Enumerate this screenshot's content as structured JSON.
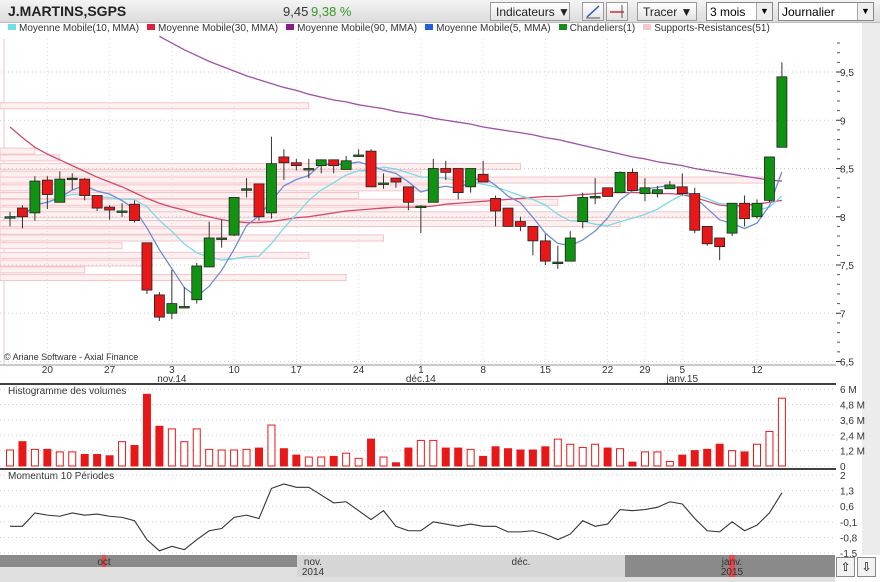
{
  "header": {
    "title": "J.MARTINS,SGPS",
    "last": "9,45",
    "change": "9,38 %",
    "indicators_label": "Indicateurs ▼",
    "draw_label": "Tracer ▼",
    "period_value": "3 mois",
    "interval_value": "Journalier",
    "dropdown_arrow": "▼"
  },
  "legend": [
    {
      "label": "Moyenne Mobile(10, MMA)",
      "color": "#6fe0e8"
    },
    {
      "label": "Moyenne Mobile(30, MMA)",
      "color": "#e0203a"
    },
    {
      "label": "Moyenne Mobile(90, MMA)",
      "color": "#8a1a8a"
    },
    {
      "label": "Moyenne Mobile(5, MMA)",
      "color": "#2060d0"
    },
    {
      "label": "Chandeliers(1)",
      "color": "#1a8a1a"
    },
    {
      "label": "Supports-Resistances(51)",
      "color": "#f6c8cc"
    }
  ],
  "copyright": "© Ariane Software - Axial Finance",
  "colors": {
    "up": "#129212",
    "down": "#e81818",
    "ma10": "#78dce4",
    "ma30": "#d04a6a",
    "ma90": "#a050a8",
    "ma5": "#6a8ed8",
    "sr": "#f4c4c8",
    "volume": "#e81818",
    "momentum": "#333333"
  },
  "chart_data": [
    {
      "type": "candlestick",
      "yticks": [
        {
          "v": 9.5,
          "l": "9,5"
        },
        {
          "v": 9,
          "l": "9"
        },
        {
          "v": 8.5,
          "l": "8,5"
        },
        {
          "v": 8,
          "l": "8"
        },
        {
          "v": 7.5,
          "l": "7,5"
        },
        {
          "v": 7,
          "l": "7"
        },
        {
          "v": 6.5,
          "l": "6,5"
        }
      ],
      "ylim": [
        6.5,
        9.85
      ],
      "xlabels": [
        {
          "i": 3,
          "l": "20"
        },
        {
          "i": 8,
          "l": "27"
        },
        {
          "i": 13,
          "l": "3",
          "sub": "nov.14"
        },
        {
          "i": 18,
          "l": "10"
        },
        {
          "i": 23,
          "l": "17"
        },
        {
          "i": 28,
          "l": "24"
        },
        {
          "i": 33,
          "l": "1",
          "sub": "déc.14"
        },
        {
          "i": 38,
          "l": "8"
        },
        {
          "i": 43,
          "l": "15"
        },
        {
          "i": 48,
          "l": "22"
        },
        {
          "i": 51,
          "l": "29"
        },
        {
          "i": 54,
          "l": "5",
          "sub": "janv.15"
        },
        {
          "i": 60,
          "l": "12"
        }
      ],
      "ohlc": [
        [
          8.0,
          8.05,
          7.9,
          8.0
        ],
        [
          8.09,
          8.12,
          7.88,
          8.0
        ],
        [
          8.04,
          8.42,
          7.96,
          8.37
        ],
        [
          8.38,
          8.42,
          8.08,
          8.23
        ],
        [
          8.15,
          8.47,
          8.15,
          8.39
        ],
        [
          8.4,
          8.45,
          8.28,
          8.4
        ],
        [
          8.39,
          8.4,
          8.17,
          8.22
        ],
        [
          8.22,
          8.22,
          8.06,
          8.09
        ],
        [
          8.1,
          8.12,
          7.97,
          8.07
        ],
        [
          8.06,
          8.14,
          8.0,
          8.06
        ],
        [
          8.13,
          8.17,
          7.94,
          7.96
        ],
        [
          7.73,
          7.73,
          7.2,
          7.24
        ],
        [
          7.19,
          7.22,
          6.92,
          6.96
        ],
        [
          7.0,
          7.45,
          6.94,
          7.1
        ],
        [
          7.07,
          7.27,
          7.05,
          7.07
        ],
        [
          7.14,
          7.52,
          7.1,
          7.49
        ],
        [
          7.48,
          7.95,
          7.48,
          7.78
        ],
        [
          7.78,
          7.97,
          7.68,
          7.78
        ],
        [
          7.81,
          8.2,
          7.8,
          8.2
        ],
        [
          8.29,
          8.4,
          8.2,
          8.29
        ],
        [
          8.34,
          8.34,
          7.96,
          8.0
        ],
        [
          8.04,
          8.83,
          7.98,
          8.55
        ],
        [
          8.62,
          8.7,
          8.38,
          8.56
        ],
        [
          8.56,
          8.6,
          8.48,
          8.53
        ],
        [
          8.5,
          8.6,
          8.4,
          8.5
        ],
        [
          8.53,
          8.59,
          8.45,
          8.59
        ],
        [
          8.59,
          8.59,
          8.45,
          8.53
        ],
        [
          8.49,
          8.63,
          8.49,
          8.58
        ],
        [
          8.64,
          8.7,
          8.62,
          8.64
        ],
        [
          8.68,
          8.7,
          8.31,
          8.31
        ],
        [
          8.35,
          8.45,
          8.29,
          8.35
        ],
        [
          8.4,
          8.4,
          8.3,
          8.36
        ],
        [
          8.31,
          8.31,
          8.07,
          8.15
        ],
        [
          8.11,
          8.12,
          7.83,
          8.11
        ],
        [
          8.15,
          8.6,
          8.15,
          8.5
        ],
        [
          8.5,
          8.58,
          8.38,
          8.46
        ],
        [
          8.5,
          8.5,
          8.18,
          8.25
        ],
        [
          8.31,
          8.5,
          8.25,
          8.5
        ],
        [
          8.44,
          8.58,
          8.36,
          8.36
        ],
        [
          8.19,
          8.22,
          7.9,
          8.06
        ],
        [
          8.09,
          8.09,
          7.9,
          7.9
        ],
        [
          7.95,
          8.0,
          7.85,
          7.9
        ],
        [
          7.9,
          7.9,
          7.6,
          7.75
        ],
        [
          7.75,
          7.82,
          7.5,
          7.54
        ],
        [
          7.53,
          7.7,
          7.46,
          7.53
        ],
        [
          7.54,
          7.85,
          7.54,
          7.78
        ],
        [
          7.95,
          8.25,
          7.88,
          8.2
        ],
        [
          8.21,
          8.4,
          8.13,
          8.21
        ],
        [
          8.3,
          8.3,
          8.21,
          8.21
        ],
        [
          8.25,
          8.47,
          8.25,
          8.46
        ],
        [
          8.46,
          8.5,
          8.27,
          8.27
        ],
        [
          8.24,
          8.4,
          8.16,
          8.3
        ],
        [
          8.24,
          8.32,
          8.2,
          8.28
        ],
        [
          8.29,
          8.37,
          8.29,
          8.33
        ],
        [
          8.31,
          8.45,
          8.22,
          8.24
        ],
        [
          8.24,
          8.3,
          7.83,
          7.86
        ],
        [
          7.9,
          7.9,
          7.7,
          7.72
        ],
        [
          7.78,
          7.78,
          7.55,
          7.69
        ],
        [
          7.83,
          8.14,
          7.8,
          8.14
        ],
        [
          8.14,
          8.22,
          7.9,
          7.98
        ],
        [
          8.0,
          8.18,
          7.98,
          8.14
        ],
        [
          8.17,
          8.62,
          8.15,
          8.62
        ],
        [
          8.72,
          9.6,
          8.72,
          9.45
        ]
      ],
      "ma30": [
        8.93,
        8.82,
        8.72,
        8.65,
        8.59,
        8.53,
        8.47,
        8.41,
        8.36,
        8.31,
        8.25,
        8.19,
        8.14,
        8.1,
        8.07,
        8.03,
        8.0,
        7.97,
        7.95,
        7.94,
        7.94,
        7.95,
        7.97,
        7.99,
        8.0,
        8.02,
        8.04,
        8.06,
        8.07,
        8.08,
        8.09,
        8.1,
        8.1,
        8.1,
        8.11,
        8.13,
        8.14,
        8.15,
        8.16,
        8.17,
        8.18,
        8.19,
        8.2,
        8.21,
        8.21,
        8.22,
        8.23,
        8.24,
        8.25,
        8.25,
        8.25,
        8.25,
        8.24,
        8.24,
        8.23,
        8.2,
        8.16,
        8.12,
        8.11,
        8.12,
        8.13,
        8.15,
        8.17
      ],
      "ma90": [
        null,
        null,
        null,
        null,
        null,
        null,
        null,
        null,
        null,
        null,
        null,
        null,
        9.87,
        9.8,
        9.73,
        9.67,
        9.61,
        9.56,
        9.51,
        9.46,
        9.42,
        9.38,
        9.34,
        9.31,
        9.27,
        9.24,
        9.21,
        9.19,
        9.16,
        9.14,
        9.12,
        9.09,
        9.07,
        9.05,
        9.02,
        9.0,
        8.98,
        8.96,
        8.93,
        8.91,
        8.89,
        8.87,
        8.85,
        8.82,
        8.8,
        8.77,
        8.74,
        8.71,
        8.68,
        8.65,
        8.62,
        8.6,
        8.57,
        8.55,
        8.53,
        8.5,
        8.48,
        8.46,
        8.44,
        8.42,
        8.4,
        8.38,
        8.37
      ],
      "supports_resistances": [
        [
          9.15,
          24
        ],
        [
          8.68,
          2
        ],
        [
          8.61,
          4
        ],
        [
          8.52,
          41
        ],
        [
          8.44,
          33
        ],
        [
          8.38,
          61
        ],
        [
          8.3,
          34
        ],
        [
          8.22,
          28
        ],
        [
          8.15,
          44
        ],
        [
          8.07,
          32
        ],
        [
          8.02,
          59
        ],
        [
          7.93,
          49
        ],
        [
          7.85,
          17
        ],
        [
          7.78,
          30
        ],
        [
          7.7,
          9
        ],
        [
          7.6,
          24
        ],
        [
          7.52,
          11
        ],
        [
          7.45,
          6
        ],
        [
          7.37,
          27
        ]
      ]
    },
    {
      "type": "bar",
      "title": "Histogramme des volumes",
      "unit": "M",
      "yticks": [
        {
          "v": 6,
          "l": "6 M"
        },
        {
          "v": 4.8,
          "l": "4,8 M"
        },
        {
          "v": 3.6,
          "l": "3,6 M"
        },
        {
          "v": 2.4,
          "l": "2,4 M"
        },
        {
          "v": 1.2,
          "l": "1,2 M"
        },
        {
          "v": 0,
          "l": "0"
        }
      ],
      "values": [
        1.25,
        1.9,
        1.3,
        1.3,
        1.1,
        1.1,
        0.9,
        0.9,
        0.8,
        1.9,
        1.6,
        5.6,
        3.1,
        2.9,
        1.9,
        2.9,
        1.3,
        1.25,
        1.25,
        1.3,
        1.4,
        3.2,
        1.35,
        0.85,
        0.7,
        0.7,
        0.75,
        1.0,
        0.6,
        2.1,
        0.7,
        0.25,
        1.4,
        2.0,
        2.0,
        1.4,
        1.4,
        1.3,
        0.75,
        1.5,
        1.35,
        1.25,
        1.25,
        1.5,
        2.1,
        1.7,
        1.45,
        1.7,
        1.4,
        1.35,
        0.3,
        1.1,
        1.1,
        0.35,
        0.85,
        1.2,
        1.3,
        1.7,
        1.2,
        1.1,
        1.7,
        2.7,
        5.3
      ]
    },
    {
      "type": "line",
      "title": "Momentum 10 Périodes",
      "yticks": [
        {
          "v": 2,
          "l": "2"
        },
        {
          "v": 1.3,
          "l": "1,3"
        },
        {
          "v": 0.6,
          "l": "0,6"
        },
        {
          "v": -0.1,
          "l": "-0,1"
        },
        {
          "v": -0.8,
          "l": "-0,8"
        },
        {
          "v": -1.5,
          "l": "-1,5"
        }
      ],
      "values": [
        -0.3,
        -0.3,
        0.3,
        0.2,
        0.15,
        0.3,
        0.2,
        0.25,
        0.15,
        0.1,
        -0.05,
        -0.9,
        -1.4,
        -1.2,
        -1.35,
        -0.9,
        -0.5,
        -0.4,
        0.1,
        0.2,
        0.05,
        1.4,
        1.6,
        1.45,
        1.45,
        1.1,
        0.75,
        0.8,
        0.4,
        0.0,
        0.4,
        -0.3,
        -0.5,
        -0.5,
        -0.1,
        -0.2,
        -0.3,
        -0.2,
        -0.3,
        -0.3,
        -0.55,
        -0.55,
        -0.5,
        -0.65,
        -0.9,
        -0.65,
        -0.05,
        -0.3,
        -0.2,
        0.45,
        0.4,
        0.45,
        0.55,
        0.8,
        0.7,
        0.05,
        -0.5,
        -0.55,
        -0.1,
        -0.5,
        -0.25,
        0.3,
        1.2
      ]
    }
  ],
  "navigator": {
    "labels": [
      {
        "l": "oct"
      },
      {
        "l": "nov.",
        "sub": "2014"
      },
      {
        "l": "déc."
      },
      {
        "l": "janv.",
        "sub": "2015"
      }
    ],
    "up_icon": "⇧",
    "down_icon": "⇩"
  }
}
